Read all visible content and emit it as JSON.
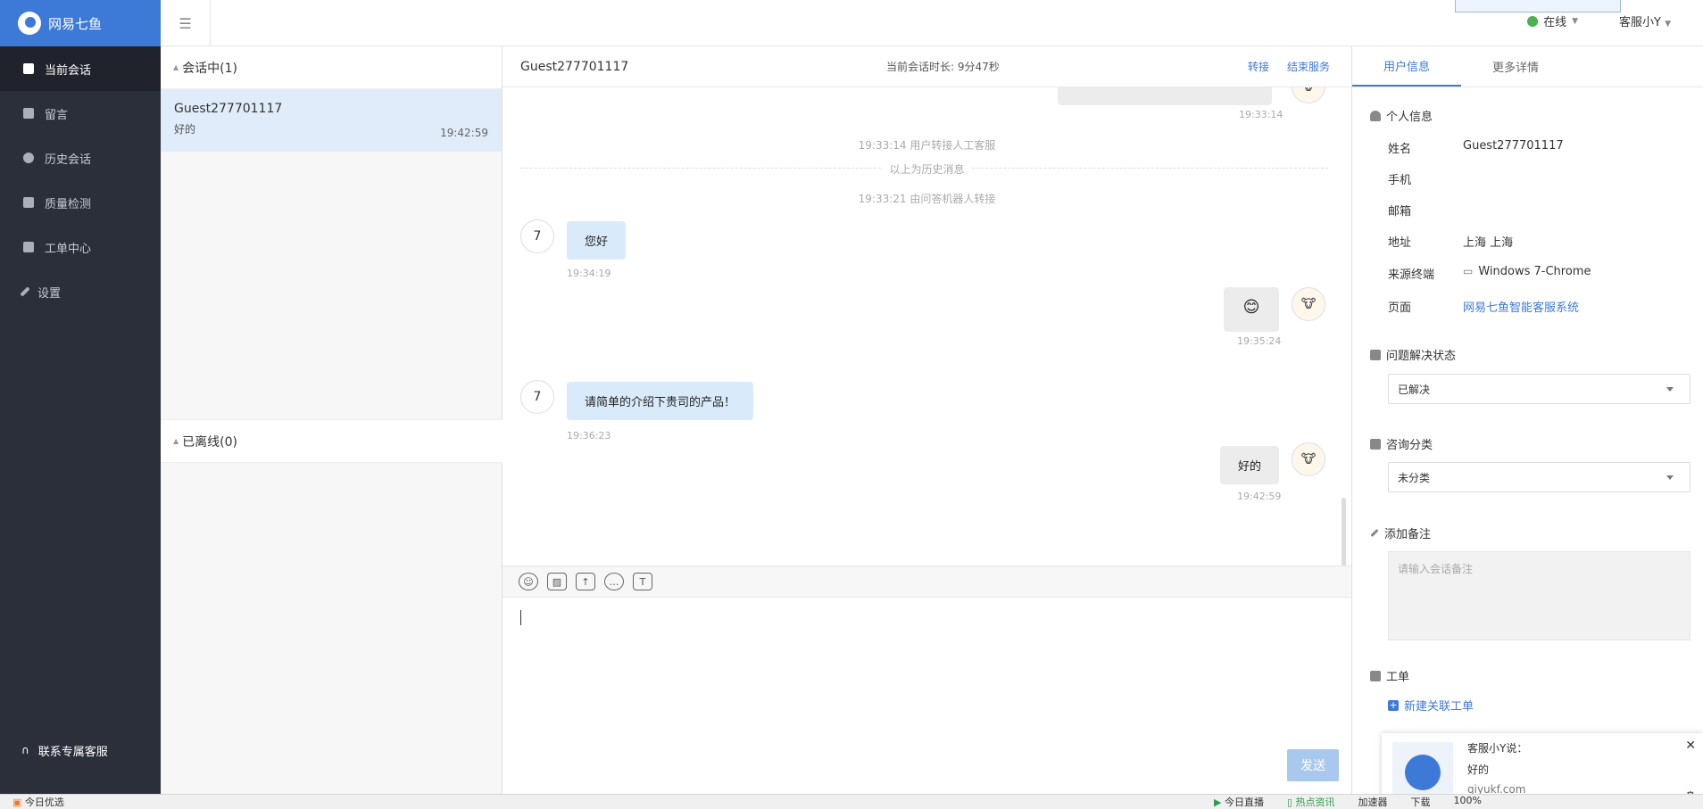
{
  "brand": {
    "name": "网易七鱼"
  },
  "nav": {
    "items": [
      {
        "label": "当前会话"
      },
      {
        "label": "留言"
      },
      {
        "label": "历史会话"
      },
      {
        "label": "质量检测"
      },
      {
        "label": "工单中心"
      },
      {
        "label": "设置"
      }
    ],
    "contact": "联系专属客服"
  },
  "topbar": {
    "status": "在线",
    "agent": "客服小Y"
  },
  "sessions": {
    "active_group": "会话中(1)",
    "offline_group": "已离线(0)",
    "items": [
      {
        "name": "Guest277701117",
        "last_message": "好的",
        "time": "19:42:59"
      }
    ]
  },
  "chat": {
    "guest": "Guest277701117",
    "duration": "当前会话时长: 9分47秒",
    "transfer": "转接",
    "end": "结束服务",
    "system": {
      "top_ts": "19:33:14",
      "transfer_note": "19:33:14 用户转接人工客服",
      "history_divider": "以上为历史消息",
      "robot_note": "19:33:21 由问答机器人转接"
    },
    "messages": [
      {
        "side": "left",
        "avatar": "7",
        "text": "您好",
        "time": "19:34:19"
      },
      {
        "side": "right",
        "text": "😊",
        "time": "19:35:24"
      },
      {
        "side": "left",
        "avatar": "7",
        "text": "请简单的介绍下贵司的产品！",
        "time": "19:36:23"
      },
      {
        "side": "right",
        "text": "好的",
        "time": "19:42:59"
      }
    ],
    "send": "发送"
  },
  "info": {
    "tabs": [
      "用户信息",
      "更多详情"
    ],
    "personal_title": "个人信息",
    "fields": [
      {
        "key": "姓名",
        "value": "Guest277701117"
      },
      {
        "key": "手机",
        "value": ""
      },
      {
        "key": "邮箱",
        "value": ""
      },
      {
        "key": "地址",
        "value": "上海 上海"
      },
      {
        "key": "来源终端",
        "value": "Windows 7-Chrome"
      },
      {
        "key": "页面",
        "value": "网易七鱼智能客服系统"
      }
    ],
    "resolve_title": "问题解决状态",
    "resolve_value": "已解决",
    "category_title": "咨询分类",
    "category_value": "未分类",
    "note_title": "添加备注",
    "note_placeholder": "请输入会话备注",
    "ticket_title": "工单",
    "new_ticket": "新建关联工单"
  },
  "notification": {
    "title": "客服小Y说：",
    "body": "好的",
    "source": "qiyukf.com"
  },
  "statusbar": {
    "left": "今日优选",
    "live": "今日直播",
    "browse": "热点资讯",
    "accel": "加速器",
    "download": "下载",
    "zoom": "100%"
  },
  "colors": {
    "accent": "#3d7ad8",
    "sidebar": "#2b2f3a",
    "bubble_left": "#d9ebfa",
    "bubble_right": "#ececec"
  }
}
